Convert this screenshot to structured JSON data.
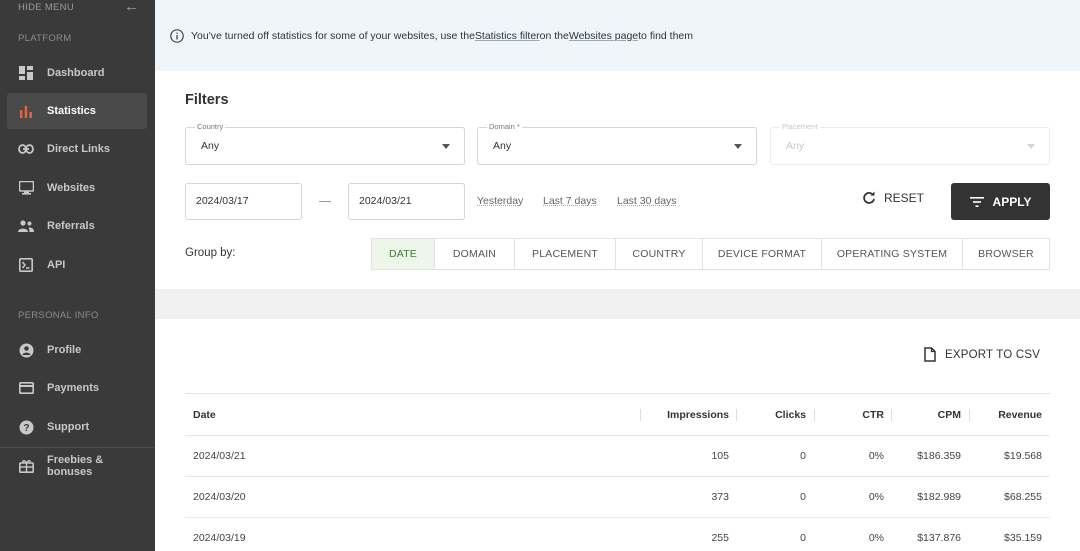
{
  "sidebar": {
    "hide_menu": "HIDE MENU",
    "platform_label": "PLATFORM",
    "personal_label": "PERSONAL INFO",
    "items": [
      {
        "label": "Dashboard",
        "icon": "dashboard-icon"
      },
      {
        "label": "Statistics",
        "icon": "bar-chart-icon",
        "active": true
      },
      {
        "label": "Direct Links",
        "icon": "link-icon"
      },
      {
        "label": "Websites",
        "icon": "monitor-icon"
      },
      {
        "label": "Referrals",
        "icon": "people-icon"
      },
      {
        "label": "API",
        "icon": "terminal-icon"
      },
      {
        "label": "Profile",
        "icon": "user-icon"
      },
      {
        "label": "Payments",
        "icon": "credit-card-icon"
      },
      {
        "label": "Support",
        "icon": "help-icon"
      },
      {
        "label": "Freebies & bonuses",
        "icon": "gift-icon"
      }
    ]
  },
  "banner": {
    "text_before": "You've turned off statistics for some of your websites, use the ",
    "link_statistics": "Statistics filter",
    "text_middle": " on the ",
    "link_websites": "Websites page",
    "text_after": " to find them"
  },
  "filters": {
    "title": "Filters",
    "country": {
      "label": "Country",
      "value": "Any"
    },
    "domain": {
      "label": "Domain *",
      "value": "Any"
    },
    "placement": {
      "label": "Placement",
      "value": "Any",
      "disabled": true
    },
    "date_from": "2024/03/17",
    "date_to": "2024/03/21",
    "quick_ranges": [
      "Yesterday",
      "Last 7 days",
      "Last 30 days"
    ],
    "reset_label": "RESET",
    "apply_label": "APPLY",
    "group_by_label": "Group by:",
    "group_by_options": [
      "DATE",
      "DOMAIN",
      "PLACEMENT",
      "COUNTRY",
      "DEVICE FORMAT",
      "OPERATING SYSTEM",
      "BROWSER"
    ],
    "group_by_selected": "DATE"
  },
  "table": {
    "export_label": "EXPORT TO CSV",
    "columns": [
      "Date",
      "Impressions",
      "Clicks",
      "CTR",
      "CPM",
      "Revenue"
    ],
    "rows": [
      [
        "2024/03/21",
        "105",
        "0",
        "0%",
        "$186.359",
        "$19.568"
      ],
      [
        "2024/03/20",
        "373",
        "0",
        "0%",
        "$182.989",
        "$68.255"
      ],
      [
        "2024/03/19",
        "255",
        "0",
        "0%",
        "$137.876",
        "$35.159"
      ]
    ]
  },
  "colors": {
    "sidebar_bg": "#3a3a3a",
    "active_accent": "#e0634a",
    "banner_bg": "#eef5fb",
    "apply_bg": "#333333",
    "group_active_bg": "#eef5ea",
    "group_active_text": "#3d7b2e"
  }
}
